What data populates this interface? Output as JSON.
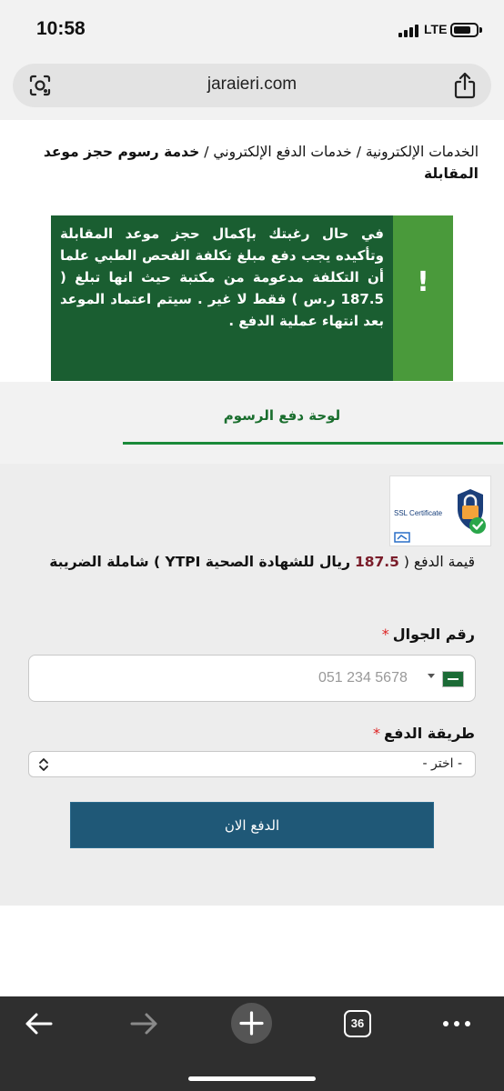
{
  "status_bar": {
    "time": "10:58",
    "network": "LTE"
  },
  "browser": {
    "url": "jaraieri.com",
    "tab_count": "36"
  },
  "breadcrumb": {
    "part1": "الخدمات الإلكترونية /",
    "part2": "خدمات الدفع الإلكتروني /",
    "current": "خدمة رسوم حجز موعد المقابلة"
  },
  "alert": {
    "icon": "!",
    "text": "في حال رغبتك بإكمال حجز موعد المقابلة وتأكيده يجب دفع مبلغ تكلفة الفحص الطبي علما أن التكلفة مدعومة من مكتبة حيث انها تبلغ ( 187.5 ر.س ) فقط لا غير . سيتم اعتماد الموعد بعد انتهاء عملية الدفع ."
  },
  "tab": {
    "label": "لوحة دفع الرسوم"
  },
  "ssl": {
    "label": "SSL Certificate"
  },
  "price": {
    "prefix": "قيمة الدفع (",
    "amount": "187.5",
    "suffix": "ريال للشهادة الصحية YTPI ) شاملة الضريبة"
  },
  "phone": {
    "label": "رقم الجوال",
    "required": "*",
    "placeholder": "051 234 5678"
  },
  "payment_method": {
    "label": "طريقة الدفع",
    "required": "*",
    "selected": "- اختر -"
  },
  "pay_button": {
    "label": "الدفع الان"
  },
  "colors": {
    "alert_bg": "#1a5e31",
    "alert_strip": "#4a9a3b",
    "tab_accent": "#1a8a3a",
    "button_bg": "#1f5877",
    "amount": "#7a1d2a"
  },
  "icons": [
    "lens-icon",
    "share-icon",
    "back-arrow-icon",
    "forward-arrow-icon",
    "plus-icon",
    "tabs-icon",
    "more-icon",
    "lock-icon",
    "check-icon",
    "saudi-flag-icon"
  ]
}
